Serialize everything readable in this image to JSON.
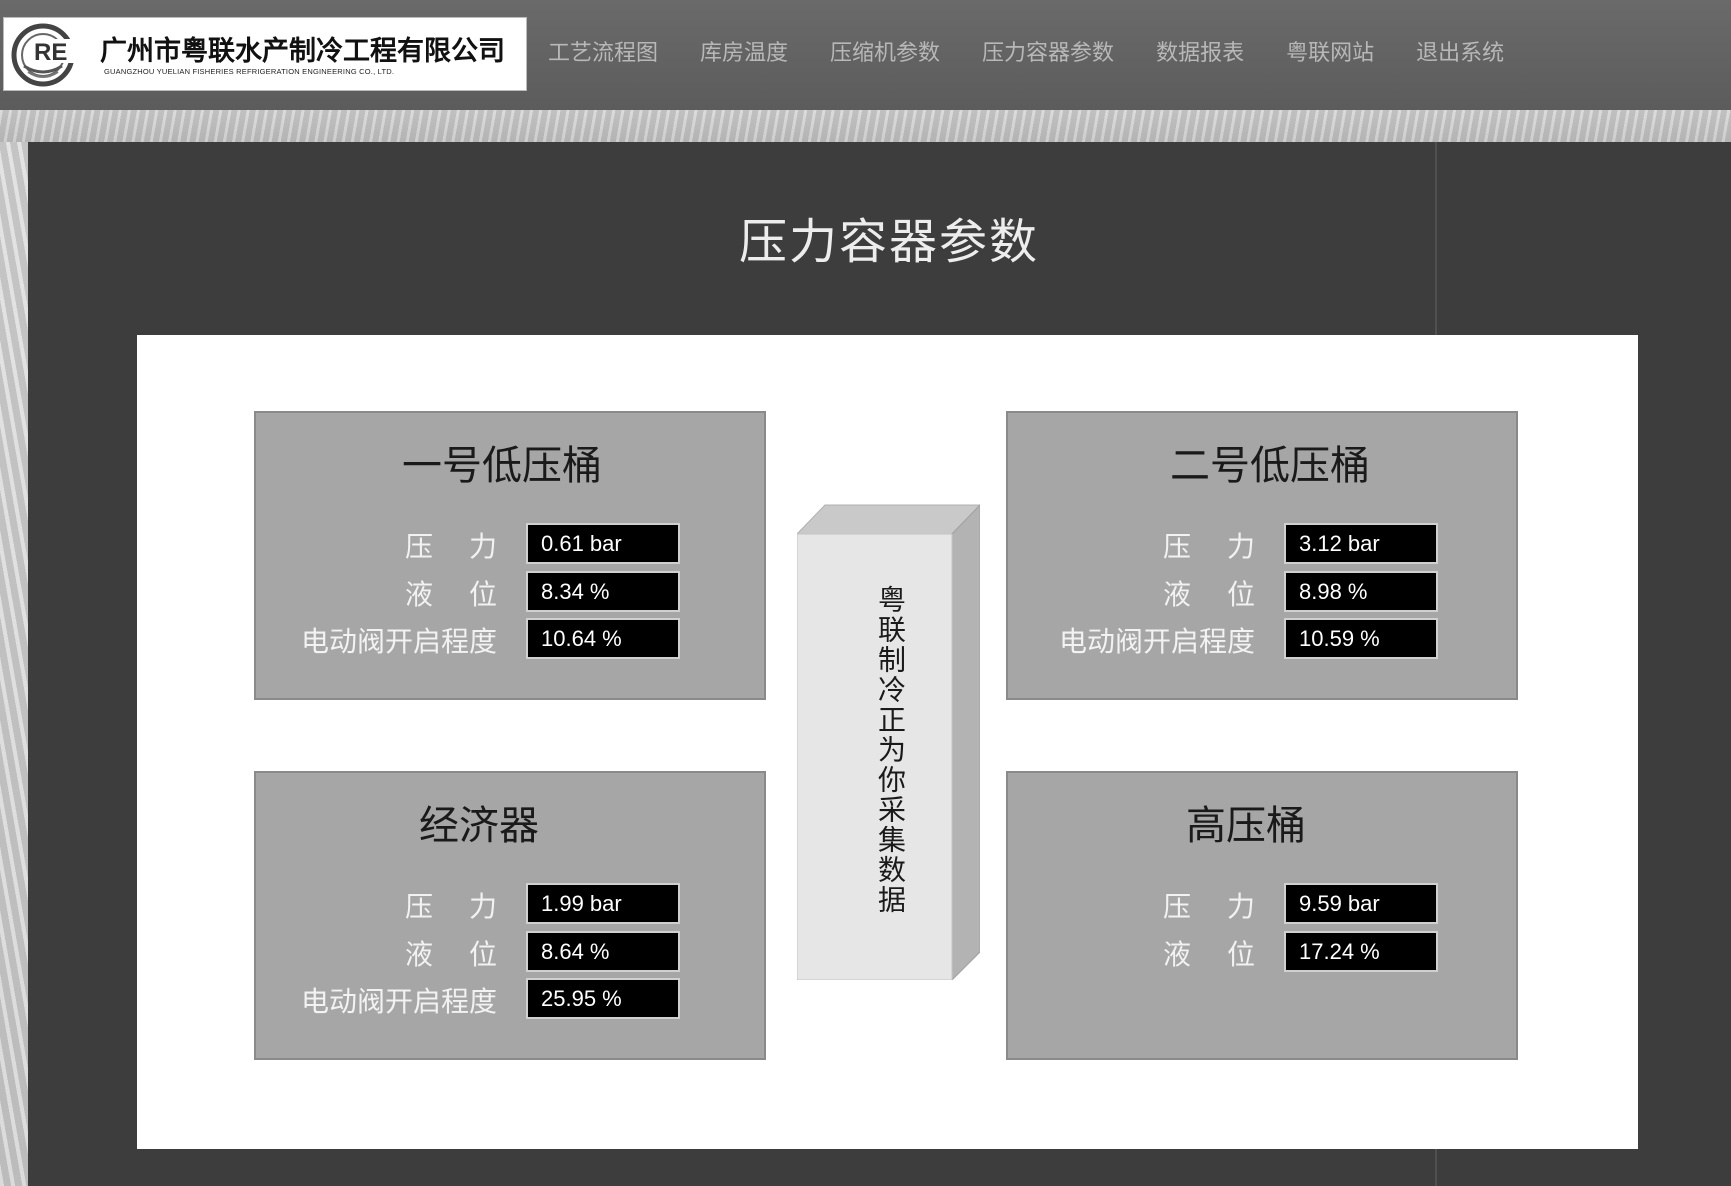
{
  "header": {
    "company_cn": "广州市粤联水产制冷工程有限公司",
    "company_en": "GUANGZHOU YUELIAN FISHERIES REFRIGERATION ENGINEERING CO., LTD.",
    "logo_letters": "RE",
    "nav": [
      {
        "label": "工艺流程图"
      },
      {
        "label": "库房温度"
      },
      {
        "label": "压缩机参数"
      },
      {
        "label": "压力容器参数"
      },
      {
        "label": "数据报表"
      },
      {
        "label": "粤联网站"
      },
      {
        "label": "退出系统"
      }
    ]
  },
  "page": {
    "title": "压力容器参数"
  },
  "center_banner": {
    "text": "粤联制冷正为你采集数据"
  },
  "labels": {
    "pressure": "压力",
    "level": "液位",
    "valve": "电动阀开启程度"
  },
  "panels": {
    "lp1": {
      "title": "一号低压桶",
      "pressure": "0.61 bar",
      "level": "8.34 %",
      "valve": "10.64 %"
    },
    "lp2": {
      "title": "二号低压桶",
      "pressure": "3.12 bar",
      "level": "8.98 %",
      "valve": "10.59 %"
    },
    "economizer": {
      "title": "经济器",
      "pressure": "1.99 bar",
      "level": "8.64 %",
      "valve": "25.95 %"
    },
    "hp": {
      "title": "高压桶",
      "pressure": "9.59 bar",
      "level": "17.24 %"
    }
  },
  "colors": {
    "panel_bg": "#a6a6a6",
    "main_bg": "#3d3d3d",
    "value_bg": "#000000"
  }
}
